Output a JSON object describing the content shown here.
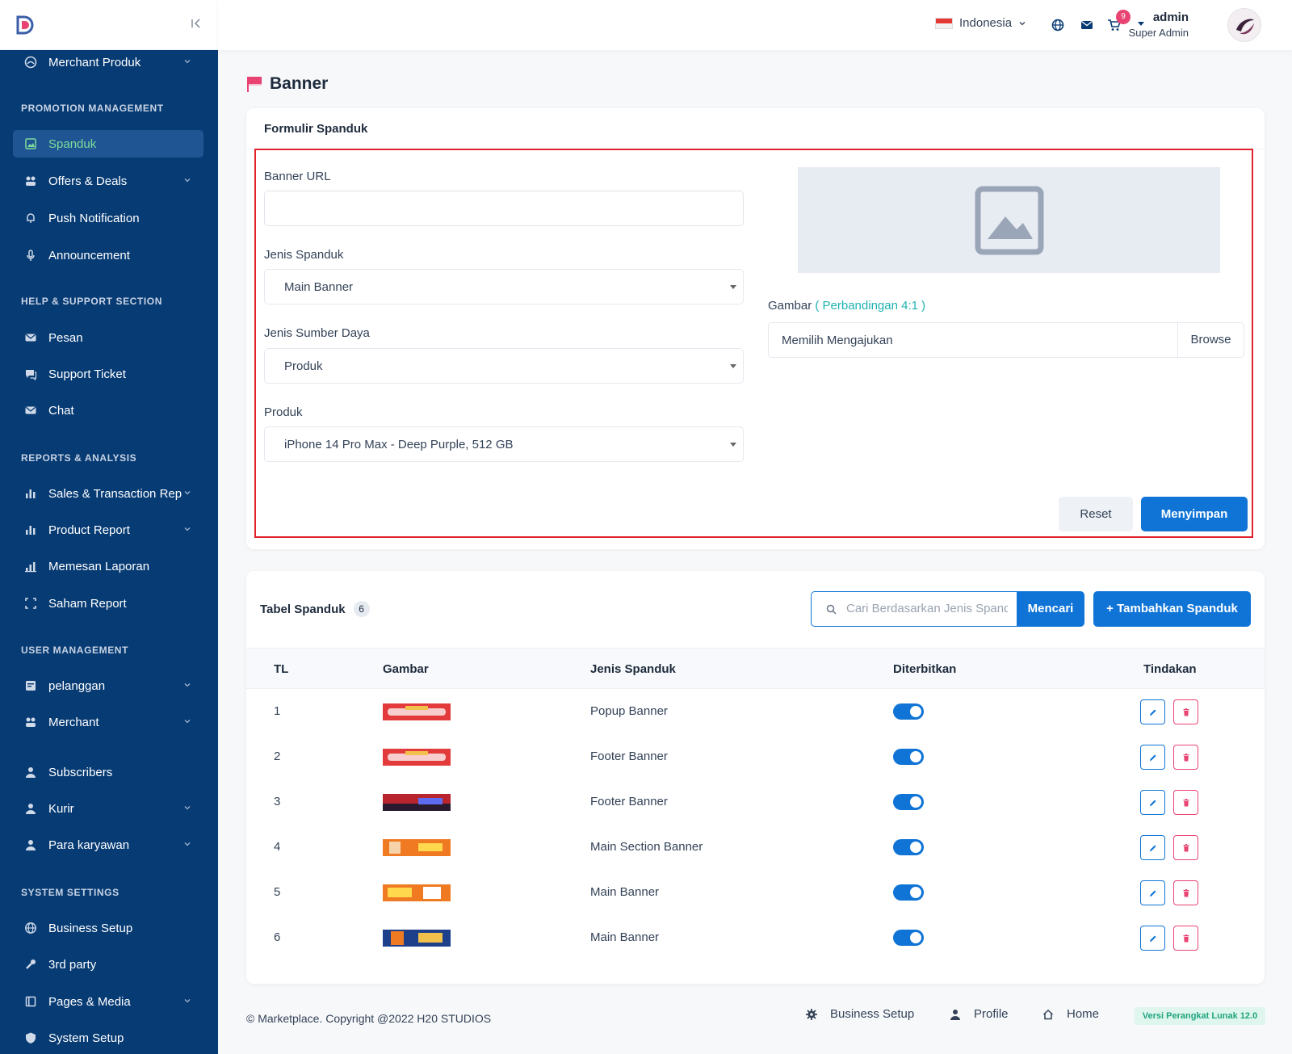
{
  "topbar": {
    "language": "Indonesia",
    "cart_count": "9",
    "user_name": "admin",
    "user_role": "Super Admin"
  },
  "sidebar": {
    "items_top": [
      {
        "label": "Merchant Produk",
        "icon": "merchant-icon"
      }
    ],
    "sections": [
      {
        "title": "PROMOTION MANAGEMENT",
        "items": [
          {
            "label": "Spanduk",
            "icon": "image-icon",
            "active": true
          },
          {
            "label": "Offers & Deals",
            "icon": "offers-icon"
          },
          {
            "label": "Push Notification",
            "icon": "bell-icon"
          },
          {
            "label": "Announcement",
            "icon": "mic-icon"
          }
        ]
      },
      {
        "title": "HELP & SUPPORT SECTION",
        "items": [
          {
            "label": "Pesan",
            "icon": "mail-icon"
          },
          {
            "label": "Support Ticket",
            "icon": "ticket-icon"
          },
          {
            "label": "Chat",
            "icon": "chat-icon"
          }
        ]
      },
      {
        "title": "REPORTS & ANALYSIS",
        "items": [
          {
            "label": "Sales & Transaction Rep",
            "icon": "bar-chart-icon"
          },
          {
            "label": "Product Report",
            "icon": "bar-chart-icon"
          },
          {
            "label": "Memesan Laporan",
            "icon": "bar-chart-icon"
          },
          {
            "label": "Saham Report",
            "icon": "expand-icon"
          }
        ]
      },
      {
        "title": "USER MANAGEMENT",
        "items": [
          {
            "label": "pelanggan",
            "icon": "customer-icon"
          },
          {
            "label": "Merchant",
            "icon": "merchant-icon"
          },
          {
            "label": "Subscribers",
            "icon": "user-icon"
          },
          {
            "label": "Kurir",
            "icon": "user-icon"
          },
          {
            "label": "Para karyawan",
            "icon": "user-icon"
          }
        ]
      },
      {
        "title": "SYSTEM SETTINGS",
        "items": [
          {
            "label": "Business Setup",
            "icon": "globe-icon"
          },
          {
            "label": "3rd party",
            "icon": "tool-icon"
          },
          {
            "label": "Pages & Media",
            "icon": "page-icon"
          },
          {
            "label": "System Setup",
            "icon": "shield-icon"
          }
        ]
      }
    ]
  },
  "page": {
    "title": "Banner"
  },
  "form": {
    "card_title": "Formulir Spanduk",
    "banner_url_label": "Banner URL",
    "banner_url_value": "",
    "jenis_spanduk_label": "Jenis Spanduk",
    "jenis_spanduk_value": "Main Banner",
    "sumber_daya_label": "Jenis Sumber Daya",
    "sumber_daya_value": "Produk",
    "produk_label": "Produk",
    "produk_value": "iPhone 14 Pro Max - Deep Purple, 512 GB",
    "gambar_label": "Gambar",
    "gambar_ratio": "( Perbandingan 4:1 )",
    "file_placeholder": "Memilih Mengajukan",
    "browse_label": "Browse",
    "reset_label": "Reset",
    "save_label": "Menyimpan"
  },
  "table": {
    "title": "Tabel Spanduk",
    "count": "6",
    "search_placeholder": "Cari Berdasarkan Jenis Spanduk",
    "search_button": "Mencari",
    "add_button": "+ Tambahkan Spanduk",
    "columns": [
      "TL",
      "Gambar",
      "Jenis Spanduk",
      "Diterbitkan",
      "Tindakan"
    ],
    "rows": [
      {
        "sl": "1",
        "type": "Popup Banner",
        "published": true
      },
      {
        "sl": "2",
        "type": "Footer Banner",
        "published": true
      },
      {
        "sl": "3",
        "type": "Footer Banner",
        "published": true
      },
      {
        "sl": "4",
        "type": "Main Section Banner",
        "published": true
      },
      {
        "sl": "5",
        "type": "Main Banner",
        "published": true
      },
      {
        "sl": "6",
        "type": "Main Banner",
        "published": true
      }
    ]
  },
  "footer": {
    "copyright": "© Marketplace. Copyright @2022 H20 STUDIOS",
    "link_business": "Business Setup",
    "link_profile": "Profile",
    "link_home": "Home",
    "version": "Versi Perangkat Lunak 12.0"
  },
  "colors": {
    "sidebar": "#073b74",
    "primary": "#0f74d6",
    "danger": "#e84372",
    "active_text": "#7ddc9b",
    "highlight": "#e0232d"
  }
}
